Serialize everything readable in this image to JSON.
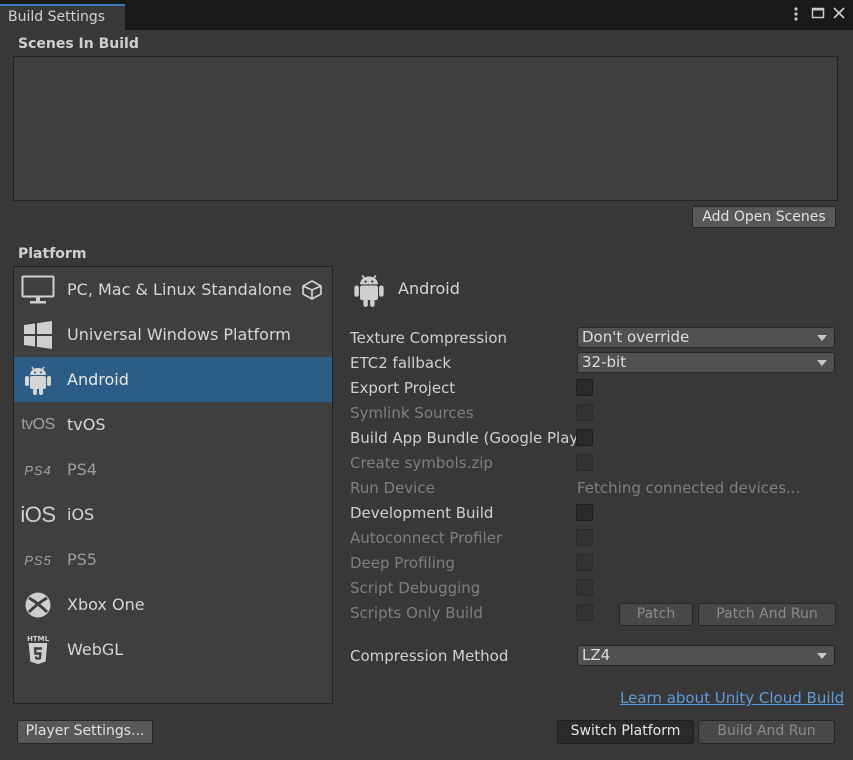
{
  "window": {
    "tab_title": "Build Settings",
    "menu_icon": "kebab-menu-icon",
    "maximize_icon": "maximize-icon",
    "close_icon": "close-icon"
  },
  "scenes": {
    "label": "Scenes In Build",
    "add_open_scenes": "Add Open Scenes"
  },
  "platform": {
    "label": "Platform",
    "items": [
      {
        "label": "PC, Mac & Linux Standalone",
        "icon": "monitor-icon",
        "active_icon": "unity-logo-icon"
      },
      {
        "label": "Universal Windows Platform",
        "icon": "windows-logo-icon"
      },
      {
        "label": "Android",
        "icon": "android-icon",
        "selected": true
      },
      {
        "label": "tvOS",
        "logo_text": "tvOS"
      },
      {
        "label": "PS4",
        "logo_text": "PS4"
      },
      {
        "label": "iOS",
        "logo_text": "iOS"
      },
      {
        "label": "PS5",
        "logo_text": "PS5"
      },
      {
        "label": "Xbox One",
        "icon": "xbox-logo-icon"
      },
      {
        "label": "WebGL",
        "icon": "html5-logo-icon",
        "logo_text": "HTML"
      }
    ]
  },
  "settings": {
    "platform_title": "Android",
    "texture_compression": {
      "label": "Texture Compression",
      "value": "Don't override"
    },
    "etc2_fallback": {
      "label": "ETC2 fallback",
      "value": "32-bit"
    },
    "export_project": {
      "label": "Export Project",
      "checked": false
    },
    "symlink_sources": {
      "label": "Symlink Sources",
      "checked": false
    },
    "build_app_bundle": {
      "label": "Build App Bundle (Google Play)",
      "checked": false
    },
    "create_symbols": {
      "label": "Create symbols.zip",
      "checked": false
    },
    "run_device": {
      "label": "Run Device",
      "value": "Fetching connected devices..."
    },
    "development_build": {
      "label": "Development Build",
      "checked": false
    },
    "autoconnect_profiler": {
      "label": "Autoconnect Profiler",
      "checked": false
    },
    "deep_profiling": {
      "label": "Deep Profiling",
      "checked": false
    },
    "script_debugging": {
      "label": "Script Debugging",
      "checked": false
    },
    "scripts_only_build": {
      "label": "Scripts Only Build",
      "checked": false
    },
    "patch": "Patch",
    "patch_and_run": "Patch And Run",
    "compression_method": {
      "label": "Compression Method",
      "value": "LZ4"
    }
  },
  "footer": {
    "cloud_build_link": "Learn about Unity Cloud Build",
    "player_settings": "Player Settings...",
    "switch_platform": "Switch Platform",
    "build_and_run": "Build And Run"
  },
  "colors": {
    "background": "#383838",
    "selection": "#2c5d87",
    "link": "#5e9bda",
    "tab_accent": "#3a79bb"
  }
}
